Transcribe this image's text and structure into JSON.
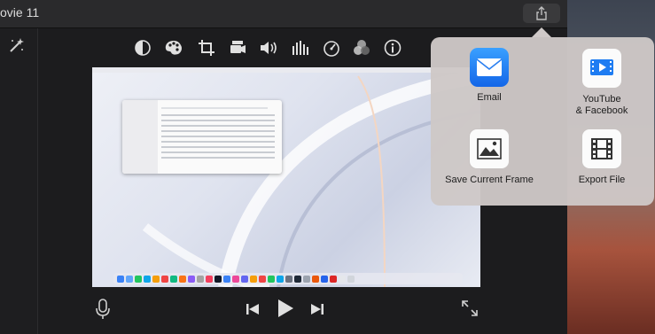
{
  "window": {
    "title": "ovie 11"
  },
  "toolbar": {
    "icons": [
      "magic-wand-icon",
      "color-balance-icon",
      "color-correction-icon",
      "crop-icon",
      "stabilization-icon",
      "volume-icon",
      "noise-reduction-icon",
      "speed-icon",
      "clip-filter-icon",
      "info-icon"
    ]
  },
  "playback": {
    "icons": [
      "microphone-icon",
      "skip-back-icon",
      "play-icon",
      "skip-forward-icon",
      "fullscreen-icon"
    ]
  },
  "share_menu": {
    "options": [
      {
        "label": "Email",
        "icon": "email-icon"
      },
      {
        "label": "YouTube\n& Facebook",
        "icon": "youtube-facebook-icon"
      },
      {
        "label": "Save Current Frame",
        "icon": "save-frame-icon"
      },
      {
        "label": "Export File",
        "icon": "export-file-icon"
      }
    ]
  },
  "colors": {
    "accent_blue": "#1e7cf2",
    "popover": "#cfc9c8"
  }
}
